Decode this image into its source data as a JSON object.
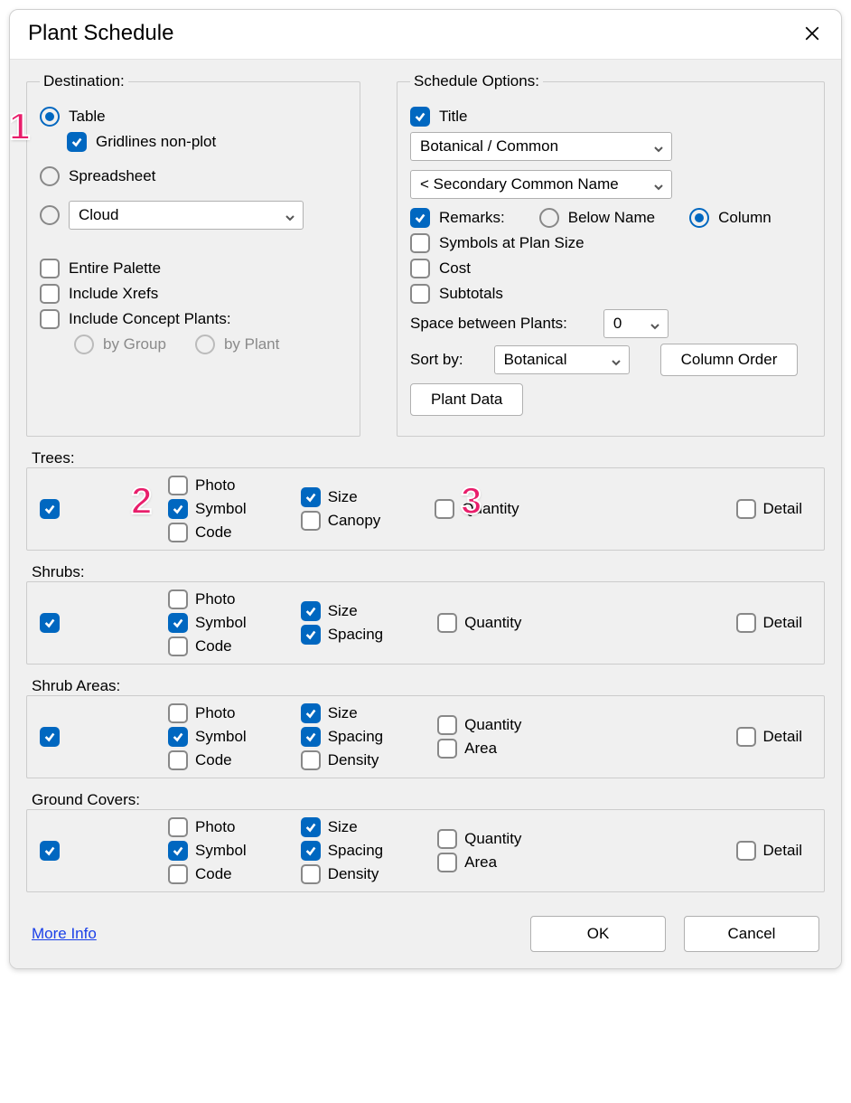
{
  "title": "Plant Schedule",
  "destination": {
    "legend": "Destination:",
    "table": "Table",
    "gridlines": "Gridlines non-plot",
    "spreadsheet": "Spreadsheet",
    "cloud": "Cloud",
    "entire_palette": "Entire Palette",
    "include_xrefs": "Include Xrefs",
    "include_concept": "Include Concept Plants:",
    "by_group": "by Group",
    "by_plant": "by Plant"
  },
  "options": {
    "legend": "Schedule Options:",
    "title_chk": "Title",
    "name_select": "Botanical / Common",
    "secondary_select": "< Secondary Common Name",
    "remarks": "Remarks:",
    "below_name": "Below Name",
    "column": "Column",
    "symbols_plan": "Symbols at Plan Size",
    "cost": "Cost",
    "subtotals": "Subtotals",
    "space_label": "Space between Plants:",
    "space_value": "0",
    "sort_label": "Sort by:",
    "sort_value": "Botanical",
    "column_order": "Column Order",
    "plant_data": "Plant Data"
  },
  "col_labels": {
    "photo": "Photo",
    "symbol": "Symbol",
    "code": "Code",
    "size": "Size",
    "canopy": "Canopy",
    "spacing": "Spacing",
    "density": "Density",
    "quantity": "Quantity",
    "area": "Area",
    "detail": "Detail"
  },
  "categories": {
    "trees": "Trees:",
    "shrubs": "Shrubs:",
    "shrub_areas": "Shrub Areas:",
    "ground_covers": "Ground Covers:"
  },
  "footer": {
    "more_info": "More Info",
    "ok": "OK",
    "cancel": "Cancel"
  },
  "annotations": {
    "a1": "1",
    "a2": "2",
    "a3": "3"
  }
}
